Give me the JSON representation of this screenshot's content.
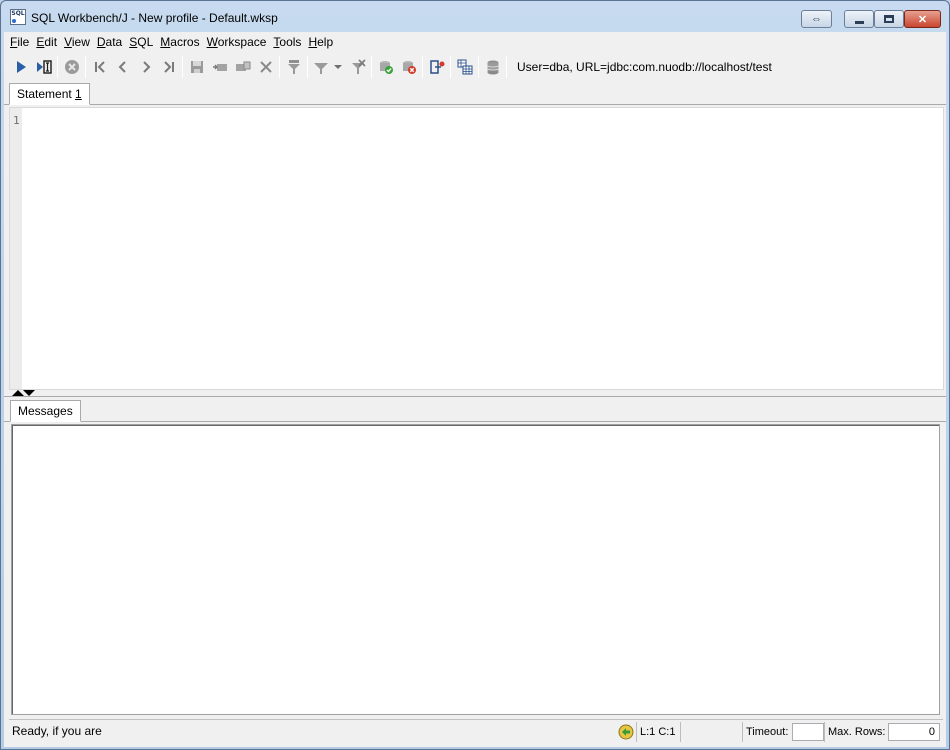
{
  "window": {
    "title": "SQL Workbench/J - New profile - Default.wksp",
    "icon_text": "SQL"
  },
  "menu": [
    {
      "mnemonic": "F",
      "rest": "ile"
    },
    {
      "mnemonic": "E",
      "rest": "dit"
    },
    {
      "mnemonic": "V",
      "rest": "iew"
    },
    {
      "mnemonic": "D",
      "rest": "ata"
    },
    {
      "mnemonic": "S",
      "rest": "QL"
    },
    {
      "mnemonic": "M",
      "rest": "acros"
    },
    {
      "mnemonic": "W",
      "rest": "orkspace"
    },
    {
      "mnemonic": "T",
      "rest": "ools"
    },
    {
      "mnemonic": "H",
      "rest": "elp"
    }
  ],
  "toolbar": {
    "connection_info": "User=dba, URL=jdbc:com.nuodb://localhost/test",
    "icons": [
      "execute-icon",
      "execute-current-icon",
      "cancel-icon",
      "first-icon",
      "previous-icon",
      "next-icon",
      "last-icon",
      "save-icon",
      "insert-row-icon",
      "copy-row-icon",
      "delete-row-icon",
      "filter-icon",
      "filter-dropdown-icon",
      "clear-filter-icon",
      "commit-icon",
      "rollback-icon",
      "disconnect-icon",
      "db-explorer-icon",
      "db-tree-icon"
    ]
  },
  "editor": {
    "tab_label": "Statement ",
    "tab_number": "1",
    "line_number": "1"
  },
  "results": {
    "tab_label": "Messages"
  },
  "statusbar": {
    "message": "Ready, if you are",
    "cursor": "L:1 C:1",
    "timeout_label": "Timeout:",
    "timeout_value": "",
    "maxrows_label": "Max. Rows:",
    "maxrows_value": "0"
  }
}
